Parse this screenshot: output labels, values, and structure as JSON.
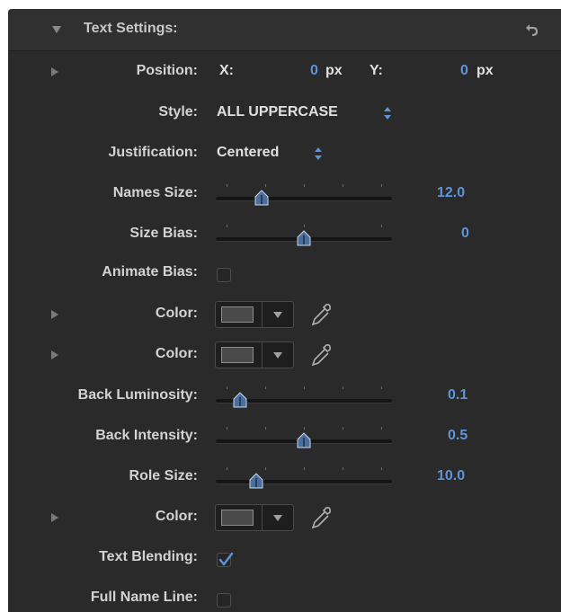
{
  "header": {
    "title": "Text Settings:",
    "reset_icon": "reset-arrow-icon"
  },
  "position": {
    "label": "Position:",
    "x_label": "X:",
    "x_value": "0",
    "x_unit": "px",
    "y_label": "Y:",
    "y_value": "0",
    "y_unit": "px"
  },
  "style": {
    "label": "Style:",
    "value": "ALL UPPERCASE"
  },
  "justification": {
    "label": "Justification:",
    "value": "Centered"
  },
  "names_size": {
    "label": "Names Size:",
    "value": "12.0",
    "level": 0.26
  },
  "size_bias": {
    "label": "Size Bias:",
    "value": "0",
    "level": 0.5
  },
  "animate_bias": {
    "label": "Animate Bias:",
    "checked": false
  },
  "color1": {
    "label": "Color:"
  },
  "color2": {
    "label": "Color:"
  },
  "back_luminosity": {
    "label": "Back Luminosity:",
    "value": "0.1",
    "level": 0.14
  },
  "back_intensity": {
    "label": "Back Intensity:",
    "value": "0.5",
    "level": 0.5
  },
  "role_size": {
    "label": "Role Size:",
    "value": "10.0",
    "level": 0.23
  },
  "color3": {
    "label": "Color:"
  },
  "text_blending": {
    "label": "Text Blending:",
    "checked": true
  },
  "full_name_line": {
    "label": "Full Name Line:",
    "checked": false
  },
  "colors": {
    "accent_blue": "#5f94d8",
    "panel_bg": "#2a2a2a",
    "swatch": "#4a4a4a"
  }
}
